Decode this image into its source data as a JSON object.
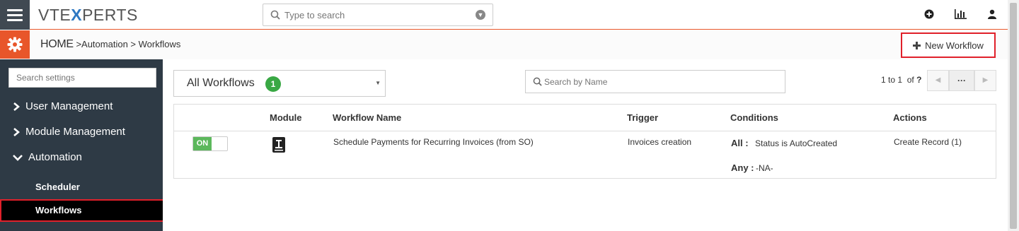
{
  "app": {
    "logo_text": "VTEXPERTS"
  },
  "topbar": {
    "search_placeholder": "Type to search",
    "icons": [
      "menu-icon",
      "plus-circle-icon",
      "bar-chart-icon",
      "user-icon"
    ]
  },
  "breadcrumb": {
    "home": "HOME",
    "sep1": ">",
    "automation": "Automation",
    "sep2": ">",
    "current": "Workflows"
  },
  "toolbar": {
    "new_workflow_label": "New Workflow",
    "new_workflow_icon": "plus-icon"
  },
  "sidebar": {
    "search_placeholder": "Search settings",
    "items": [
      {
        "label": "User Management",
        "icon": "chevron-right-icon"
      },
      {
        "label": "Module Management",
        "icon": "chevron-right-icon"
      },
      {
        "label": "Automation",
        "icon": "chevron-down-icon"
      }
    ],
    "subitems": [
      {
        "label": "Scheduler"
      },
      {
        "label": "Workflows",
        "active": true
      }
    ]
  },
  "filter": {
    "selected": "All Workflows",
    "count": "1"
  },
  "name_search": {
    "placeholder": "Search by Name"
  },
  "pagination": {
    "range": "1 to 1",
    "of_label": "of",
    "total": "?",
    "more_label": "···"
  },
  "table": {
    "headers": {
      "module": "Module",
      "name": "Workflow Name",
      "trigger": "Trigger",
      "conditions": "Conditions",
      "actions": "Actions"
    },
    "rows": [
      {
        "status": "ON",
        "module_icon": "invoice-icon",
        "name": "Schedule Payments for Recurring Invoices (from SO)",
        "trigger": "Invoices creation",
        "all_label": "All :",
        "all_value": "Status is AutoCreated",
        "any_label": "Any :",
        "any_value": "-NA-",
        "action": "Create Record (1)"
      }
    ]
  },
  "colors": {
    "accent": "#e8562a",
    "sidebar": "#2e3a45",
    "highlight": "#e0202a",
    "on_green": "#5cb85c",
    "badge_green": "#39a844",
    "logo_x": "#2e78c2"
  }
}
